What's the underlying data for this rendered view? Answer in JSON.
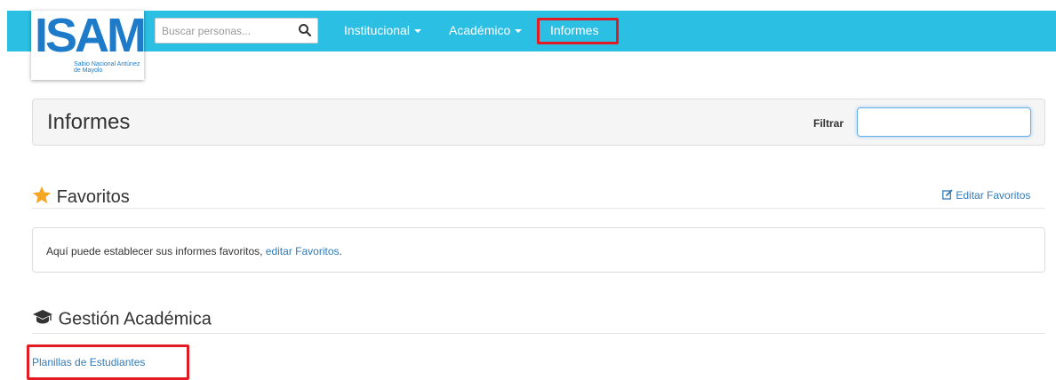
{
  "brand": {
    "logo_text": "ISAM",
    "logo_subtitle": "Sabio Nacional Antúnez de Mayolo"
  },
  "navbar": {
    "search_placeholder": "Buscar personas...",
    "items": [
      {
        "label": "Institucional",
        "dropdown": true
      },
      {
        "label": "Académico",
        "dropdown": true
      },
      {
        "label": "Informes",
        "dropdown": false,
        "highlighted": true
      }
    ]
  },
  "header": {
    "title": "Informes",
    "filter_label": "Filtrar",
    "filter_value": ""
  },
  "favorites": {
    "title": "Favoritos",
    "edit_link": "Editar Favoritos",
    "message_prefix": "Aquí puede establecer sus informes favoritos, ",
    "message_link": "editar Favoritos",
    "message_suffix": "."
  },
  "academic": {
    "title": "Gestión Académica",
    "reports": [
      "Planillas de Estudiantes"
    ]
  },
  "colors": {
    "navbar": "#2bbfe3",
    "brand_blue": "#1d7bc9",
    "link": "#337ab7",
    "highlight_red": "#e31b23",
    "star": "#f5a623"
  },
  "icons": {
    "search": "search-icon",
    "star": "star-icon",
    "edit": "edit-icon",
    "graduation": "graduation-cap-icon"
  }
}
